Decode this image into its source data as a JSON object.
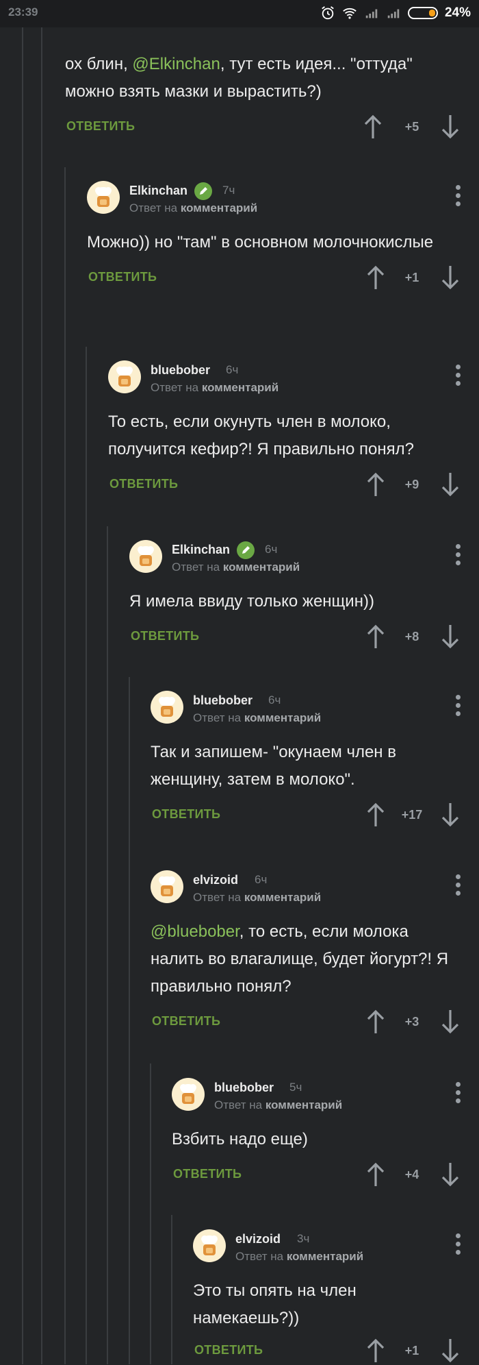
{
  "status_bar": {
    "time": "23:39",
    "battery": "24%"
  },
  "labels": {
    "reply_on": "Ответ на",
    "comment": "комментарий",
    "reply_button": "ОТВЕТИТЬ"
  },
  "top_comment": {
    "text_before": "ох блин, ",
    "mention": "@Elkinchan",
    "text_after": ", тут есть идея... \"оттуда\" можно взять мазки и вырастить?)",
    "score": "+5"
  },
  "comments": [
    {
      "author": "Elkinchan",
      "time": "7ч",
      "text": "Можно)) но \"там\" в основном молочнокислые",
      "score": "+1"
    },
    {
      "author": "bluebober",
      "time": "6ч",
      "text": "То есть, если окунуть член в молоко, получится кефир?! Я правильно понял?",
      "score": "+9"
    },
    {
      "author": "Elkinchan",
      "time": "6ч",
      "text": "Я имела ввиду только женщин))",
      "score": "+8"
    },
    {
      "author": "bluebober",
      "time": "6ч",
      "text": "Так и запишем- \"окунаем член в женщину, затем в молоко\".",
      "score": "+17"
    },
    {
      "author": "elvizoid",
      "time": "6ч",
      "mention": "@bluebober",
      "text": ", то есть, если молока налить во влагалище, будет йогурт?! Я правильно понял?",
      "score": "+3"
    },
    {
      "author": "bluebober",
      "time": "5ч",
      "text": "Взбить надо еще)",
      "score": "+4"
    },
    {
      "author": "elvizoid",
      "time": "3ч",
      "text": "Это ты опять на член намекаешь?))",
      "score": "+1"
    }
  ],
  "colors": {
    "background": "#232527",
    "accent": "#6d9a3e",
    "mention": "#8ac15a",
    "badge": "#6aa844"
  }
}
